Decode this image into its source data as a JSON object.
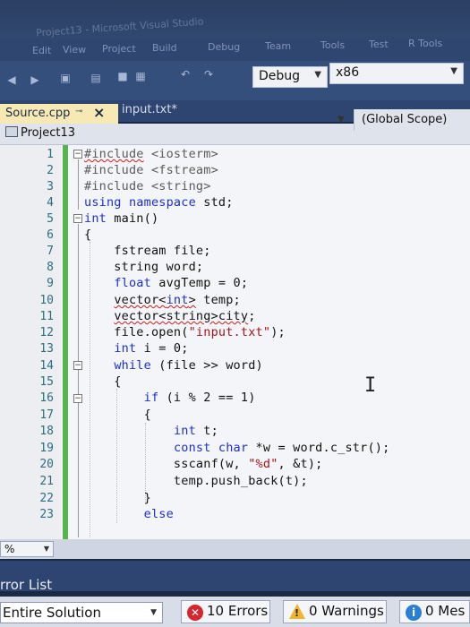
{
  "window": {
    "title": "Project13 - Microsoft Visual Studio"
  },
  "menu": [
    "Edit",
    "View",
    "Project",
    "Build",
    "Debug",
    "Team",
    "Tools",
    "Test",
    "R Tools"
  ],
  "toolbar": {
    "config": "Debug",
    "platform": "x86"
  },
  "tabs": {
    "active": "Source.cpp",
    "inactive": "input.txt*"
  },
  "navbar": {
    "project": "Project13",
    "scope": "(Global Scope)"
  },
  "editor": {
    "line_numbers": [
      "1",
      "2",
      "3",
      "4",
      "5",
      "6",
      "7",
      "8",
      "9",
      "10",
      "11",
      "12",
      "13",
      "14",
      "15",
      "16",
      "17",
      "18",
      "19",
      "20",
      "21",
      "22",
      "23"
    ],
    "cursor": "I"
  },
  "zoom": {
    "level": "% "
  },
  "error_list": {
    "title": "rror List",
    "scope": "Entire Solution",
    "errors": "10 Errors",
    "warnings": "0 Warnings",
    "messages": "0 Mes"
  },
  "colors": {
    "keyword": "#1b2fd3",
    "string": "#a3151b",
    "change_bar": "#57b34e",
    "error": "#d3262f"
  }
}
